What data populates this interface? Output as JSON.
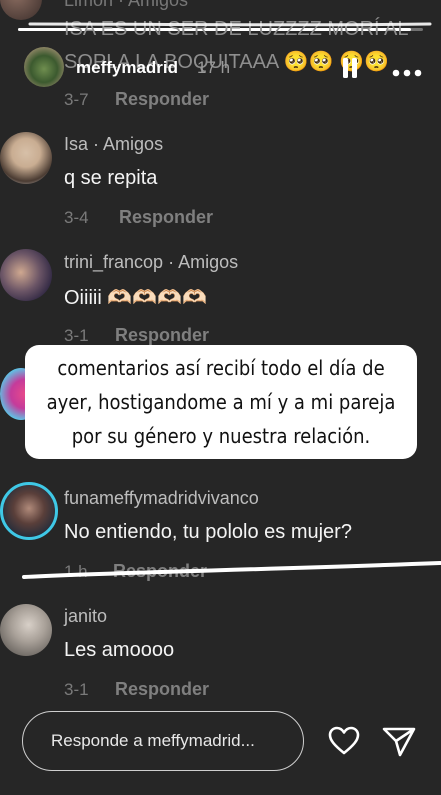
{
  "story": {
    "username": "meffymadrid",
    "time": "17 h",
    "progress": 0.97
  },
  "top_partial": {
    "username": "Limon · Amigos",
    "comment_line1": "ISA ES UN SER DE LUZZZZ MORÍ AL",
    "comment_line2": "SOPLA LA BOQUITAAA 🥺🥺 🥺🥺",
    "time": "3-7",
    "reply": "Responder"
  },
  "comments": [
    {
      "username": "Isa",
      "relation": "Amigos",
      "text": "q se repita",
      "time": "3-4",
      "reply": "Responder"
    },
    {
      "username": "trini_francop",
      "relation": "Amigos",
      "text": "Oiiiii 🫶🏻🫶🏻🫶🏻🫶🏻",
      "time": "3-1",
      "reply": "Responder"
    },
    {
      "username": "funameffymadridvivanco",
      "relation": "",
      "text": "No entiendo, tu pololo es mujer?",
      "time": "1 h",
      "reply": "Responder"
    },
    {
      "username": "janito",
      "relation": "",
      "text": "Les amoooo",
      "time": "3-1",
      "reply": "Responder"
    }
  ],
  "overlay": {
    "line1": "comentarios así recibí todo el día de",
    "line2": "ayer, hostigandome a mí y a mi pareja",
    "line3": "por su género y nuestra relación."
  },
  "input": {
    "placeholder": "Responde a meffymadrid..."
  },
  "colors": {
    "background": "#262626",
    "text_primary": "#f4f4f4",
    "text_secondary": "#7f7f7f",
    "overlay_bg": "#ffffff",
    "story_ring": "#3fc8e6"
  }
}
